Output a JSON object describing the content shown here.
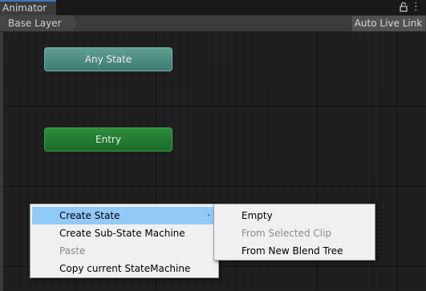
{
  "window": {
    "tab_title": "Animator",
    "kebab_glyph": "⋮"
  },
  "toolbar": {
    "breadcrumb": "Base Layer",
    "auto_live_link": "Auto Live Link"
  },
  "graph": {
    "nodes": [
      {
        "label": "Any State",
        "color": "#4f8f84"
      },
      {
        "label": "Entry",
        "color": "#237c32"
      }
    ]
  },
  "context_menu": {
    "items": [
      {
        "label": "Create State",
        "highlighted": true,
        "has_submenu": true,
        "submenu_glyph": "›"
      },
      {
        "label": "Create Sub-State Machine",
        "enabled": true
      },
      {
        "label": "Paste",
        "enabled": false
      },
      {
        "label": "Copy current StateMachine",
        "enabled": true
      }
    ]
  },
  "submenu": {
    "items": [
      {
        "label": "Empty",
        "enabled": true
      },
      {
        "label": "From Selected Clip",
        "enabled": false
      },
      {
        "label": "From New Blend Tree",
        "enabled": true
      }
    ]
  },
  "colors": {
    "menu_highlight": "#91c9f7",
    "tab_accent": "#3a79bb"
  }
}
